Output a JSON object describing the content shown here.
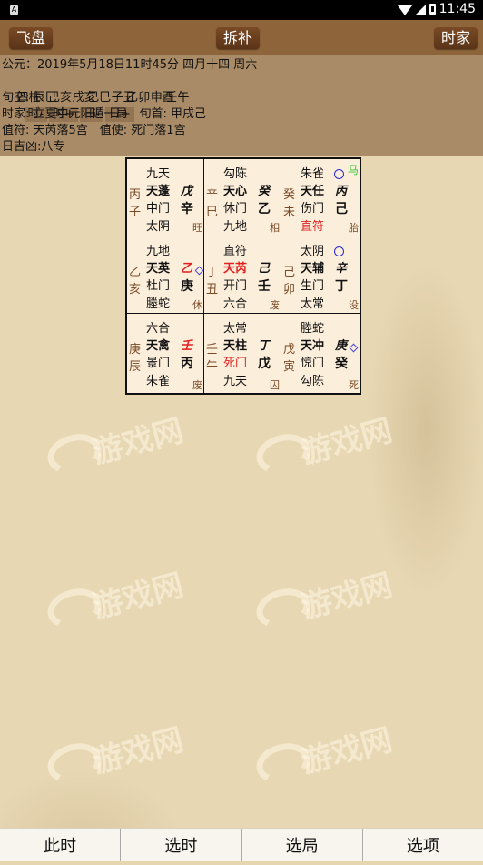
{
  "status_bar": {
    "time": "11:45",
    "notification_icon": "A"
  },
  "toolbar": {
    "left": "飞盘",
    "center": "拆补",
    "right": "时家"
  },
  "info": {
    "line1": "公元：2019年5月18日11时45分 四月十四 周六",
    "pillars_label": "四柱: 己亥　 己巳　 乙卯　 壬午",
    "buttons": [
      "时-",
      "时+",
      "日-",
      "日+"
    ],
    "line3": "旬空: 辰巳　 戌亥　 子丑　 申酉",
    "line4": "时家: 立夏中元阳遁一局　旬首: 甲戌己",
    "line5": "值符: 天芮落5宫　值使: 死门落1宫",
    "line6": "日吉凶:八专"
  },
  "palaces": [
    {
      "stem": "丙子",
      "deity": "九天",
      "star": "天蓬",
      "door": "中门",
      "god": "太阴",
      "heaven": "戊",
      "earth": "辛",
      "state": "旺"
    },
    {
      "stem": "辛巳",
      "deity": "勾陈",
      "star": "天心",
      "door": "休门",
      "god": "九地",
      "heaven": "癸",
      "earth": "乙",
      "state": "相"
    },
    {
      "stem": "癸未",
      "deity": "朱雀",
      "star": "天任",
      "door": "伤门",
      "god": "直符",
      "heaven": "丙",
      "earth": "己",
      "state": "胎",
      "horse": "马"
    },
    {
      "stem": "乙亥",
      "deity": "九地",
      "star": "天英",
      "door": "杜门",
      "god": "塍蛇",
      "heaven": "乙",
      "earth": "庚",
      "state": "休"
    },
    {
      "stem": "丁丑",
      "deity": "直符",
      "star": "天芮",
      "door": "开门",
      "god": "六合",
      "heaven": "己",
      "earth": "壬",
      "state": "废"
    },
    {
      "stem": "己卯",
      "deity": "太阴",
      "star": "天辅",
      "door": "生门",
      "god": "太常",
      "heaven": "辛",
      "earth": "丁",
      "state": "没"
    },
    {
      "stem": "庚辰",
      "deity": "六合",
      "star": "天禽",
      "door": "景门",
      "god": "朱雀",
      "heaven": "壬",
      "earth": "丙",
      "state": "废"
    },
    {
      "stem": "壬午",
      "deity": "太常",
      "star": "天柱",
      "door": "死门",
      "god": "九天",
      "heaven": "丁",
      "earth": "戊",
      "state": "囚"
    },
    {
      "stem": "戊寅",
      "deity": "塍蛇",
      "star": "天冲",
      "door": "惊门",
      "god": "勾陈",
      "heaven": "庚",
      "earth": "癸",
      "state": "死"
    }
  ],
  "watermark": "游戏网",
  "bottom_bar": [
    "此时",
    "选时",
    "选局",
    "选项"
  ],
  "colors": {
    "toolbar": "#8e653a",
    "info_bg": "#a98b67",
    "grid_bg": "#fbeedb",
    "red_highlight": "#e02020",
    "horse": "#2ecc2e"
  }
}
